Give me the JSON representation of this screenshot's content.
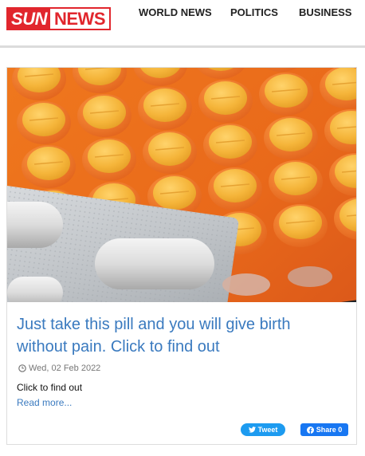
{
  "header": {
    "logo": {
      "part1": "SUN",
      "part2": "NEWS",
      "brand_color": "#e1262d"
    },
    "nav": [
      {
        "label": "WORLD NEWS"
      },
      {
        "label": "POLITICS"
      },
      {
        "label": "BUSINESS"
      }
    ]
  },
  "article": {
    "image_subject": "orange blister pack of yellow pills with white capsules",
    "title": "Just take this pill and you will give birth without pain. Click to find out",
    "date": "Wed, 02 Feb 2022",
    "excerpt": "Click to find out",
    "read_more": "Read more...",
    "accent_color": "#3a7abf"
  },
  "share": {
    "tweet_label": "Tweet",
    "facebook_label": "Share 0",
    "tweet_color": "#1d9bf0",
    "facebook_color": "#1877f2"
  }
}
